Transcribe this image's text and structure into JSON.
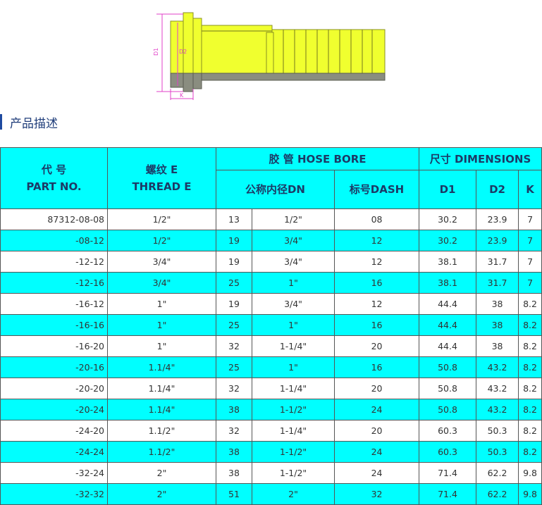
{
  "colors": {
    "accent": "#00ffff",
    "heading_bar": "#1f4aa0",
    "fitting": "#f0ff2f",
    "hex_dark": "#8a8d80",
    "dim_line": "#e040c8"
  },
  "figure": {
    "icon": "hose-fitting-drawing",
    "labels": {
      "d1": "D1",
      "d2": "D2",
      "k": "K"
    }
  },
  "heading": {
    "title": "产品描述"
  },
  "table": {
    "h_part_cn": "代 号",
    "h_part_en": "PART NO.",
    "h_thread_cn": "螺纹 E",
    "h_thread_en": "THREAD E",
    "h_hose_bore": "胶 管 HOSE BORE",
    "h_dims": "尺寸 DIMENSIONS",
    "h_dn": "公称内径DN",
    "h_dash": "标号DASH",
    "h_d1": "D1",
    "h_d2": "D2",
    "h_k": "K",
    "rows": [
      {
        "part": "87312-08-08",
        "thread": "1/2\"",
        "dn_mm": "13",
        "dn_in": "1/2\"",
        "dash": "08",
        "d1": "30.2",
        "d2": "23.9",
        "k": "7"
      },
      {
        "part": "-08-12",
        "thread": "1/2\"",
        "dn_mm": "19",
        "dn_in": "3/4\"",
        "dash": "12",
        "d1": "30.2",
        "d2": "23.9",
        "k": "7"
      },
      {
        "part": "-12-12",
        "thread": "3/4\"",
        "dn_mm": "19",
        "dn_in": "3/4\"",
        "dash": "12",
        "d1": "38.1",
        "d2": "31.7",
        "k": "7"
      },
      {
        "part": "-12-16",
        "thread": "3/4\"",
        "dn_mm": "25",
        "dn_in": "1\"",
        "dash": "16",
        "d1": "38.1",
        "d2": "31.7",
        "k": "7"
      },
      {
        "part": "-16-12",
        "thread": "1\"",
        "dn_mm": "19",
        "dn_in": "3/4\"",
        "dash": "12",
        "d1": "44.4",
        "d2": "38",
        "k": "8.2"
      },
      {
        "part": "-16-16",
        "thread": "1\"",
        "dn_mm": "25",
        "dn_in": "1\"",
        "dash": "16",
        "d1": "44.4",
        "d2": "38",
        "k": "8.2"
      },
      {
        "part": "-16-20",
        "thread": "1\"",
        "dn_mm": "32",
        "dn_in": "1-1/4\"",
        "dash": "20",
        "d1": "44.4",
        "d2": "38",
        "k": "8.2"
      },
      {
        "part": "-20-16",
        "thread": "1.1/4\"",
        "dn_mm": "25",
        "dn_in": "1\"",
        "dash": "16",
        "d1": "50.8",
        "d2": "43.2",
        "k": "8.2"
      },
      {
        "part": "-20-20",
        "thread": "1.1/4\"",
        "dn_mm": "32",
        "dn_in": "1-1/4\"",
        "dash": "20",
        "d1": "50.8",
        "d2": "43.2",
        "k": "8.2"
      },
      {
        "part": "-20-24",
        "thread": "1.1/4\"",
        "dn_mm": "38",
        "dn_in": "1-1/2\"",
        "dash": "24",
        "d1": "50.8",
        "d2": "43.2",
        "k": "8.2"
      },
      {
        "part": "-24-20",
        "thread": "1.1/2\"",
        "dn_mm": "32",
        "dn_in": "1-1/4\"",
        "dash": "20",
        "d1": "60.3",
        "d2": "50.3",
        "k": "8.2"
      },
      {
        "part": "-24-24",
        "thread": "1.1/2\"",
        "dn_mm": "38",
        "dn_in": "1-1/2\"",
        "dash": "24",
        "d1": "60.3",
        "d2": "50.3",
        "k": "8.2"
      },
      {
        "part": "-32-24",
        "thread": "2\"",
        "dn_mm": "38",
        "dn_in": "1-1/2\"",
        "dash": "24",
        "d1": "71.4",
        "d2": "62.2",
        "k": "9.8"
      },
      {
        "part": "-32-32",
        "thread": "2\"",
        "dn_mm": "51",
        "dn_in": "2\"",
        "dash": "32",
        "d1": "71.4",
        "d2": "62.2",
        "k": "9.8"
      }
    ]
  }
}
